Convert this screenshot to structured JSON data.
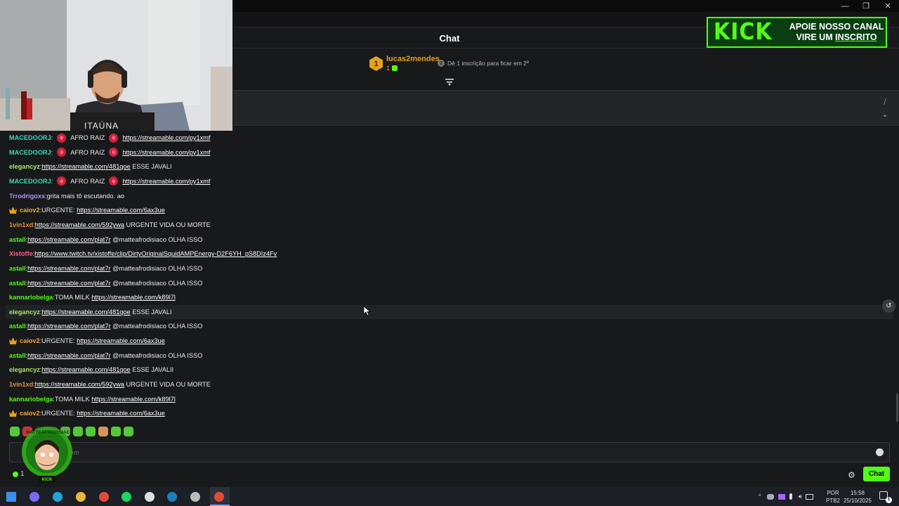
{
  "window": {
    "minimize_glyph": "—",
    "restore_glyph": "❐",
    "close_glyph": "✕"
  },
  "header": {
    "title": "Chat"
  },
  "kick_banner": {
    "logo": "KICK",
    "line1": "APOIE NOSSO CANAL",
    "line2_prefix": "VIRE UM ",
    "line2_emph": "INSCRITO",
    "accent": "#53fc18"
  },
  "leaderboard": {
    "rank": "1",
    "username": "lucas2mendes",
    "count": "1",
    "hint": "Dê 1 inscrição para ficar em 2º",
    "hint_icon": "2"
  },
  "pinned": {
    "hide_icon": "⧸",
    "expand_icon": "⌄"
  },
  "webcam": {
    "shirt_text": "ITAÚNA"
  },
  "messages": [
    {
      "user": "MACEDOORJ",
      "color": "#3fd6b6",
      "parts": [
        {
          "t": "gem"
        },
        {
          "t": "text",
          "v": "AFRO RAIZ"
        },
        {
          "t": "gem"
        },
        {
          "t": "link",
          "v": "https://streamable.com/py1xmf"
        }
      ]
    },
    {
      "user": "MACEDOORJ",
      "color": "#3fd6b6",
      "parts": [
        {
          "t": "gem"
        },
        {
          "t": "text",
          "v": "AFRO RAIZ"
        },
        {
          "t": "gem"
        },
        {
          "t": "link",
          "v": "https://streamable.com/py1xmf"
        }
      ]
    },
    {
      "user": "elegancyz",
      "color": "#a6e56b",
      "parts": [
        {
          "t": "link",
          "v": "https://streamable.com/481qoe"
        },
        {
          "t": "text",
          "v": " ESSE JAVALI"
        }
      ]
    },
    {
      "user": "MACEDOORJ",
      "color": "#3fd6b6",
      "parts": [
        {
          "t": "gem"
        },
        {
          "t": "text",
          "v": "AFRO RAIZ"
        },
        {
          "t": "gem"
        },
        {
          "t": "link",
          "v": "https://streamable.com/py1xmf"
        }
      ]
    },
    {
      "user": "Trrodrigoxs",
      "color": "#b48cff",
      "parts": [
        {
          "t": "text",
          "v": "grita mais tô escutando. ao"
        }
      ]
    },
    {
      "user": "caiov2",
      "color": "#f2a93b",
      "crown": true,
      "parts": [
        {
          "t": "text",
          "v": "URGENTE: "
        },
        {
          "t": "link",
          "v": "https://streamable.com/6ax3ue"
        }
      ]
    },
    {
      "user": "1vin1xd",
      "color": "#f08a3a",
      "parts": [
        {
          "t": "link",
          "v": "https://streamable.com/592ywa"
        },
        {
          "t": "text",
          "v": " URGENTE VIDA OU MORTE"
        }
      ]
    },
    {
      "user": "astall",
      "color": "#53fc18",
      "parts": [
        {
          "t": "link",
          "v": "https://streamable.com/plat7r"
        },
        {
          "t": "text",
          "v": " @matteafrodisiaco OLHA ISSO"
        }
      ]
    },
    {
      "user": "Xistoffe",
      "color": "#ff5a8a",
      "parts": [
        {
          "t": "link",
          "v": "https://www.twitch.tv/xistoffe/clip/DirtyOriginalSquidAMPEnergy-D2F6YH_pS8DIz4Fv"
        }
      ]
    },
    {
      "user": "astall",
      "color": "#53fc18",
      "parts": [
        {
          "t": "link",
          "v": "https://streamable.com/plat7r"
        },
        {
          "t": "text",
          "v": " @matteafrodisiaco OLHA ISSO"
        }
      ]
    },
    {
      "user": "astall",
      "color": "#53fc18",
      "parts": [
        {
          "t": "link",
          "v": "https://streamable.com/plat7r"
        },
        {
          "t": "text",
          "v": " @matteafrodisiaco OLHA ISSO"
        }
      ]
    },
    {
      "user": "kannariobelga",
      "color": "#53fc18",
      "parts": [
        {
          "t": "text",
          "v": "TOMA MILK "
        },
        {
          "t": "link",
          "v": "https://streamable.com/k89l7l"
        }
      ]
    },
    {
      "user": "elegancyz",
      "color": "#a6e56b",
      "highlight": true,
      "parts": [
        {
          "t": "link",
          "v": "https://streamable.com/481qoe"
        },
        {
          "t": "text",
          "v": " ESSE JAVALI"
        }
      ]
    },
    {
      "user": "astall",
      "color": "#53fc18",
      "parts": [
        {
          "t": "link",
          "v": "https://streamable.com/plat7r"
        },
        {
          "t": "text",
          "v": " @matteafrodisiaco OLHA ISSO"
        }
      ]
    },
    {
      "user": "caiov2",
      "color": "#f2a93b",
      "crown": true,
      "parts": [
        {
          "t": "text",
          "v": "URGENTE: "
        },
        {
          "t": "link",
          "v": "https://streamable.com/6ax3ue"
        }
      ]
    },
    {
      "user": "astall",
      "color": "#53fc18",
      "parts": [
        {
          "t": "link",
          "v": "https://streamable.com/plat7r"
        },
        {
          "t": "text",
          "v": " @matteafrodisiaco OLHA ISSO"
        }
      ]
    },
    {
      "user": "elegancyz",
      "color": "#a6e56b",
      "parts": [
        {
          "t": "link",
          "v": "https://streamable.com/481qoe"
        },
        {
          "t": "text",
          "v": " ESSE JAVALII"
        }
      ]
    },
    {
      "user": "1vin1xd",
      "color": "#f08a3a",
      "parts": [
        {
          "t": "link",
          "v": "https://streamable.com/592ywa"
        },
        {
          "t": "text",
          "v": " URGENTE VIDA OU MORTE"
        }
      ]
    },
    {
      "user": "kannariobelga",
      "color": "#53fc18",
      "parts": [
        {
          "t": "text",
          "v": "TOMA MILK "
        },
        {
          "t": "link",
          "v": "https://streamable.com/k89l7l"
        }
      ]
    },
    {
      "user": "caiov2",
      "color": "#f2a93b",
      "crown": true,
      "parts": [
        {
          "t": "text",
          "v": "URGENTE: "
        },
        {
          "t": "link",
          "v": "https://streamable.com/6ax3ue"
        }
      ]
    }
  ],
  "composer": {
    "placeholder": "gem",
    "avatar_text": "MATTEAFRODISIACO",
    "avatar_sub": "KICK"
  },
  "bottom": {
    "points": "1",
    "chat_button": "Chat",
    "gear_icon": "⚙"
  },
  "taskbar": {
    "apps": [
      "start-icon",
      "copilot-icon",
      "edge-icon",
      "file-explorer-icon",
      "chrome-icon",
      "spotify-icon",
      "github-icon",
      "steam-icon",
      "obs-icon",
      "chrome-active-icon"
    ],
    "lang1": "POR",
    "lang2": "PTB2",
    "time": "15:58",
    "date": "25/10/2025",
    "notification_count": "1"
  }
}
